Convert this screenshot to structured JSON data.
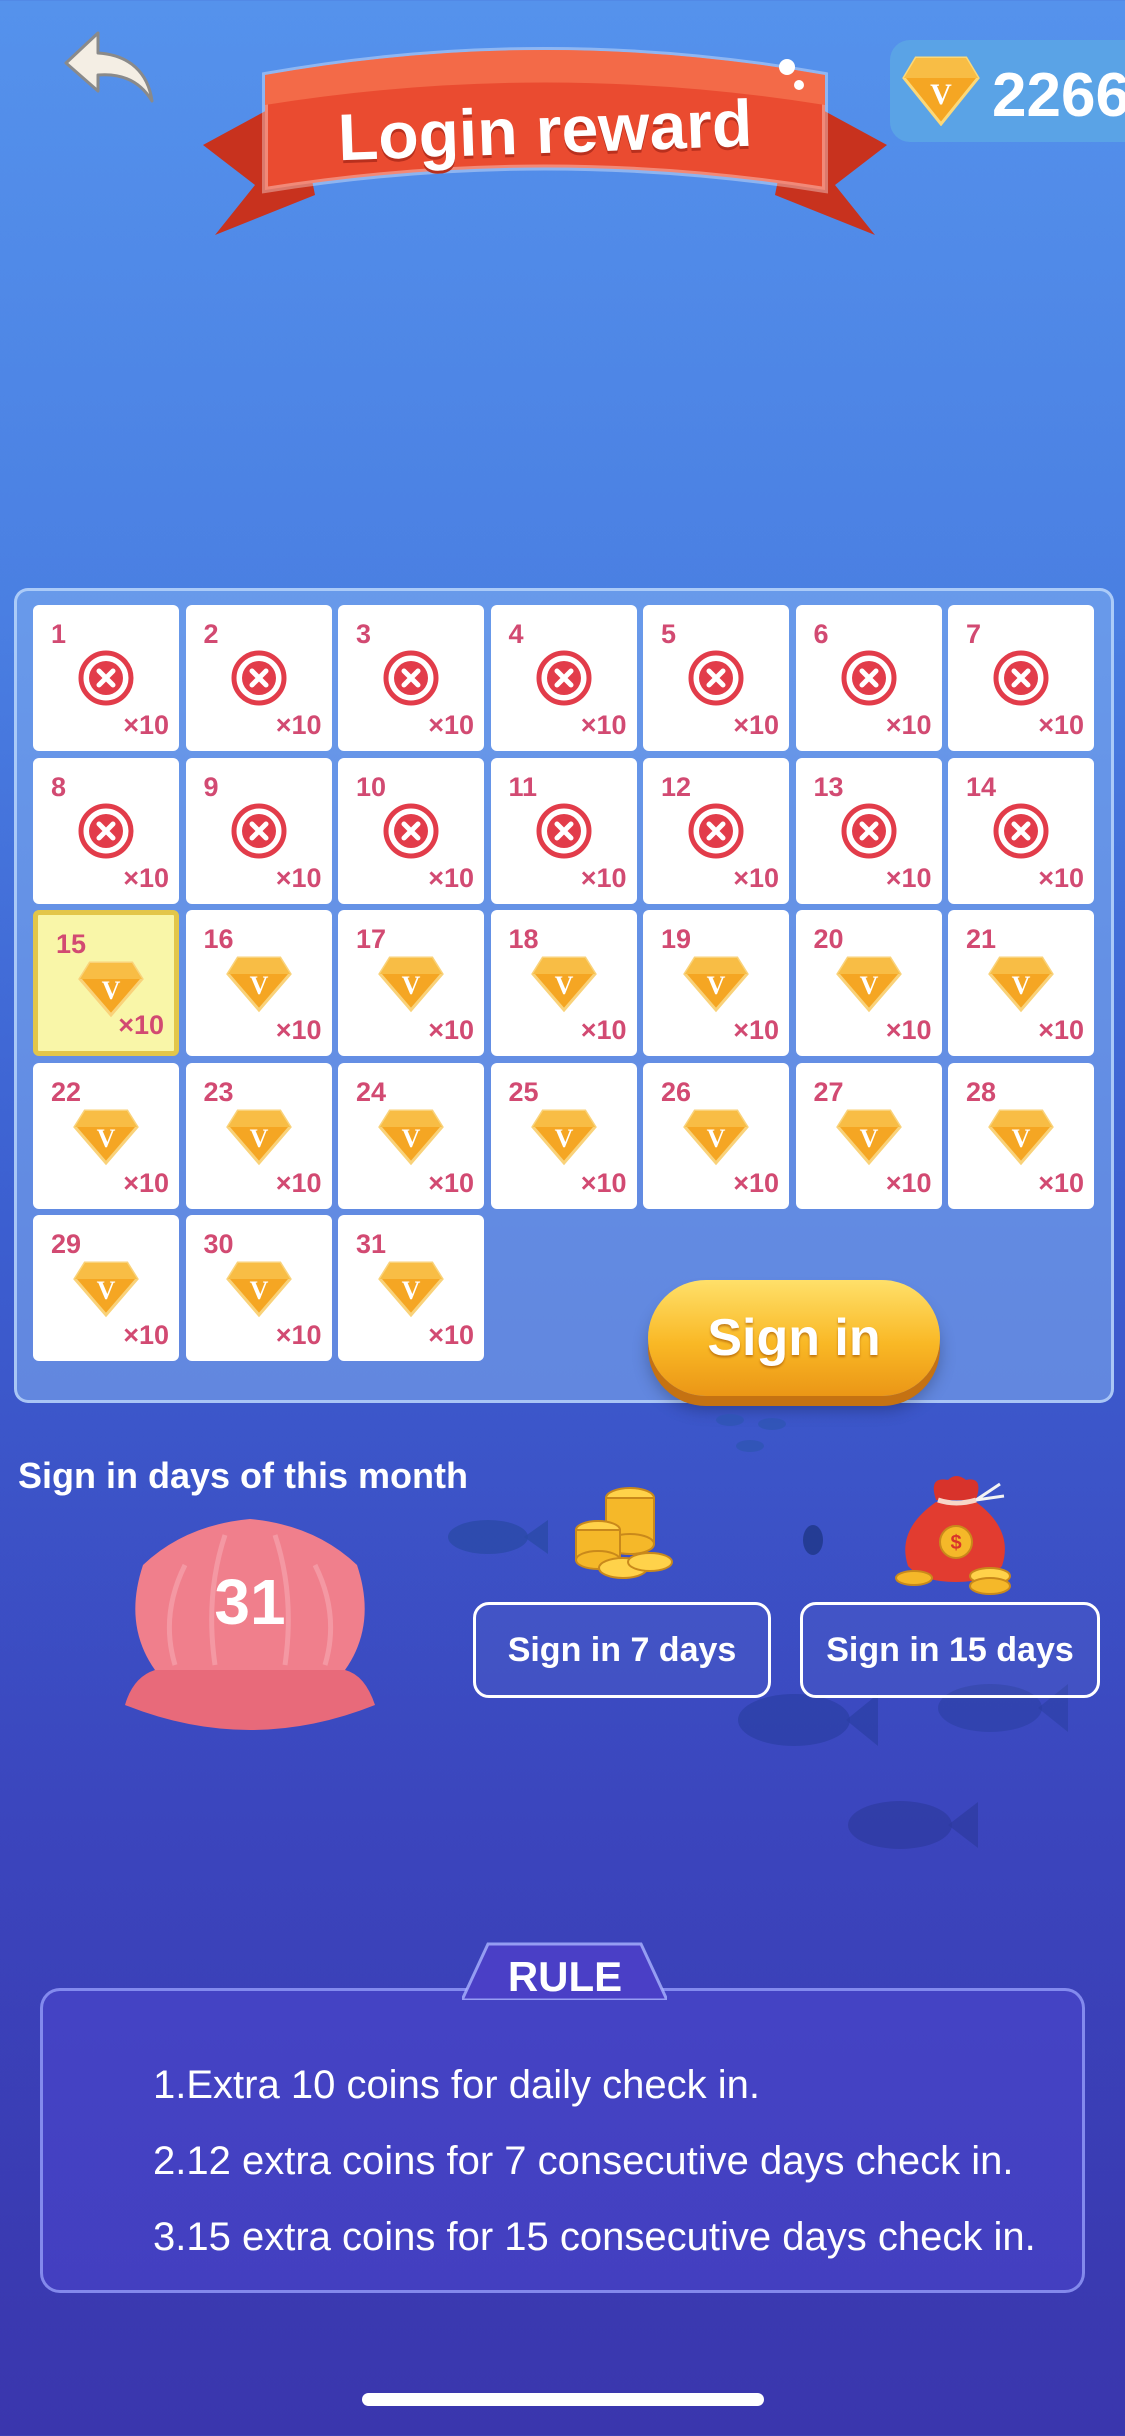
{
  "header": {
    "title": "Login reward",
    "coin_count": "2266"
  },
  "calendar": {
    "multiplier": "×10",
    "days": [
      {
        "day": "1",
        "state": "missed"
      },
      {
        "day": "2",
        "state": "missed"
      },
      {
        "day": "3",
        "state": "missed"
      },
      {
        "day": "4",
        "state": "missed"
      },
      {
        "day": "5",
        "state": "missed"
      },
      {
        "day": "6",
        "state": "missed"
      },
      {
        "day": "7",
        "state": "missed"
      },
      {
        "day": "8",
        "state": "missed"
      },
      {
        "day": "9",
        "state": "missed"
      },
      {
        "day": "10",
        "state": "missed"
      },
      {
        "day": "11",
        "state": "missed"
      },
      {
        "day": "12",
        "state": "missed"
      },
      {
        "day": "13",
        "state": "missed"
      },
      {
        "day": "14",
        "state": "missed"
      },
      {
        "day": "15",
        "state": "today"
      },
      {
        "day": "16",
        "state": "upcoming"
      },
      {
        "day": "17",
        "state": "upcoming"
      },
      {
        "day": "18",
        "state": "upcoming"
      },
      {
        "day": "19",
        "state": "upcoming"
      },
      {
        "day": "20",
        "state": "upcoming"
      },
      {
        "day": "21",
        "state": "upcoming"
      },
      {
        "day": "22",
        "state": "upcoming"
      },
      {
        "day": "23",
        "state": "upcoming"
      },
      {
        "day": "24",
        "state": "upcoming"
      },
      {
        "day": "25",
        "state": "upcoming"
      },
      {
        "day": "26",
        "state": "upcoming"
      },
      {
        "day": "27",
        "state": "upcoming"
      },
      {
        "day": "28",
        "state": "upcoming"
      },
      {
        "day": "29",
        "state": "upcoming"
      },
      {
        "day": "30",
        "state": "upcoming"
      },
      {
        "day": "31",
        "state": "upcoming"
      }
    ],
    "sign_in_label": "Sign in"
  },
  "month": {
    "label": "Sign in days of this month",
    "days_count": "31",
    "bonus_7_label": "Sign in 7 days",
    "bonus_15_label": "Sign in 15 days"
  },
  "rule": {
    "title": "RULE",
    "lines": [
      "1.Extra 10 coins for daily check in.",
      "2.12 extra coins for 7 consecutive days check in.",
      "3.15 extra coins for 15 consecutive days check in."
    ]
  },
  "colors": {
    "accent_red": "#e8452f",
    "day_text": "#d24a72",
    "gem_orange": "#f5a623",
    "today_bg": "#f9f6a8"
  }
}
